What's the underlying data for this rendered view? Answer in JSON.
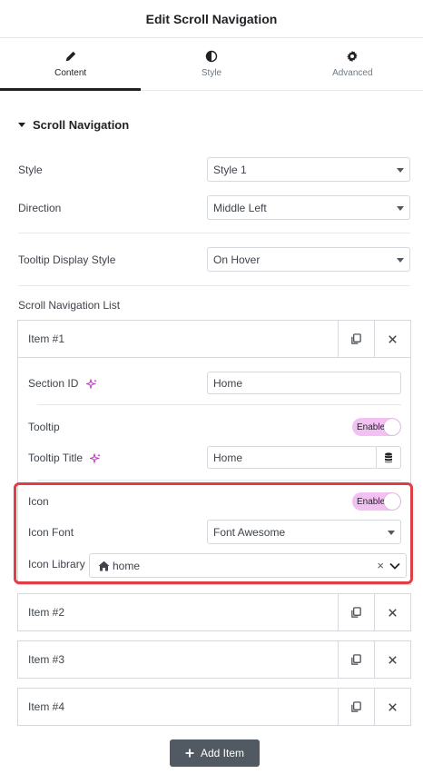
{
  "header": {
    "title": "Edit Scroll Navigation"
  },
  "tabs": [
    {
      "label": "Content",
      "icon": "pencil-icon"
    },
    {
      "label": "Style",
      "icon": "half-circle-icon"
    },
    {
      "label": "Advanced",
      "icon": "gear-icon"
    }
  ],
  "section": {
    "title": "Scroll Navigation"
  },
  "fields": {
    "style": {
      "label": "Style",
      "value": "Style 1"
    },
    "direction": {
      "label": "Direction",
      "value": "Middle Left"
    },
    "tooltip_display": {
      "label": "Tooltip Display Style",
      "value": "On Hover"
    }
  },
  "list": {
    "label": "Scroll Navigation List",
    "items": [
      {
        "title": "Item #1"
      },
      {
        "title": "Item #2"
      },
      {
        "title": "Item #3"
      },
      {
        "title": "Item #4"
      }
    ],
    "expanded": {
      "section_id": {
        "label": "Section ID",
        "value": "Home"
      },
      "tooltip": {
        "label": "Tooltip",
        "toggle": "Enable"
      },
      "tooltip_title": {
        "label": "Tooltip Title",
        "value": "Home"
      },
      "icon": {
        "label": "Icon",
        "toggle": "Enable"
      },
      "icon_font": {
        "label": "Icon Font",
        "value": "Font Awesome"
      },
      "icon_library": {
        "label": "Icon Library",
        "value": "home",
        "clear": "×"
      }
    }
  },
  "add_item": {
    "label": "Add Item"
  },
  "colors": {
    "highlight": "#e03e45",
    "toggle_bg": "#f3c1f1",
    "ai_accent": "#c036c4",
    "active_tab": "#1f2124"
  }
}
